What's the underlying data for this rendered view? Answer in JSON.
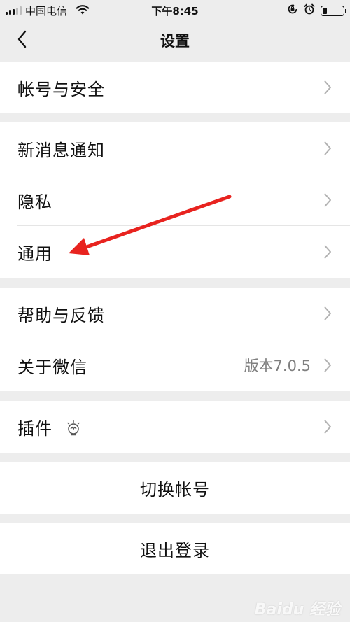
{
  "status_bar": {
    "carrier": "中国电信",
    "time": "下午8:45"
  },
  "nav": {
    "title": "设置"
  },
  "groups": [
    {
      "items": [
        {
          "label": "帐号与安全"
        }
      ]
    },
    {
      "items": [
        {
          "label": "新消息通知"
        },
        {
          "label": "隐私"
        },
        {
          "label": "通用"
        }
      ]
    },
    {
      "items": [
        {
          "label": "帮助与反馈"
        },
        {
          "label": "关于微信",
          "value": "版本7.0.5"
        }
      ]
    },
    {
      "items": [
        {
          "label": "插件"
        }
      ]
    }
  ],
  "actions": {
    "switch_account": "切换帐号",
    "logout": "退出登录"
  },
  "annotation": {
    "arrow_color": "#e8231f"
  },
  "watermark": "Baidu 经验",
  "icons": [
    "signal-icon",
    "wifi-icon",
    "rotation-lock-icon",
    "alarm-icon",
    "battery-icon",
    "back-chevron-icon",
    "chevron-right-icon",
    "plugin-bulb-icon"
  ]
}
